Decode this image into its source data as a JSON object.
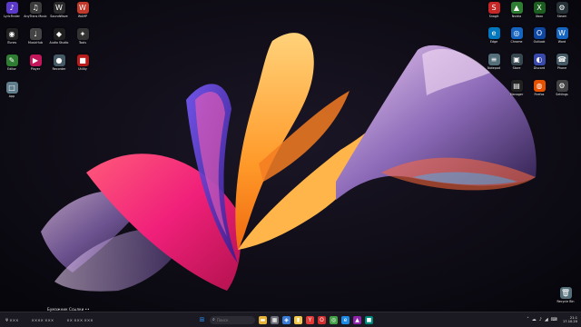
{
  "desktop": {
    "left_icons": [
      {
        "label": "LyricFinder",
        "glyph": "♪",
        "color": "#5a39c8"
      },
      {
        "label": "AnyTrans Music",
        "glyph": "♫",
        "color": "#3b3b3b"
      },
      {
        "label": "SoundWave",
        "glyph": "W",
        "color": "#2a2a2a"
      },
      {
        "label": "WAMP",
        "glyph": "W",
        "color": "#c0392b"
      },
      {
        "label": "iTunes",
        "glyph": "◉",
        "color": "#222222"
      },
      {
        "label": "MusicHub",
        "glyph": "♩",
        "color": "#444444"
      },
      {
        "label": "Audio Studio",
        "glyph": "◆",
        "color": "#1f1f1f"
      },
      {
        "label": "Tools",
        "glyph": "✦",
        "color": "#333333"
      },
      {
        "label": "Editor",
        "glyph": "✎",
        "color": "#2e7d32"
      },
      {
        "label": "Player",
        "glyph": "▶",
        "color": "#c2185b"
      },
      {
        "label": "Recorder",
        "glyph": "●",
        "color": "#455a64"
      },
      {
        "label": "Utility",
        "glyph": "■",
        "color": "#b71c1c"
      },
      {
        "label": "App",
        "glyph": "□",
        "color": "#607d8b"
      }
    ],
    "right_icons": [
      {
        "label": "Snagit",
        "glyph": "S",
        "color": "#c62828"
      },
      {
        "label": "Nvidia",
        "glyph": "▲",
        "color": "#2e7d32"
      },
      {
        "label": "Xbox",
        "glyph": "X",
        "color": "#1b5e20"
      },
      {
        "label": "Steam",
        "glyph": "⚙",
        "color": "#263238"
      },
      {
        "label": "Edge",
        "glyph": "e",
        "color": "#0277bd"
      },
      {
        "label": "Chrome",
        "glyph": "◎",
        "color": "#1565c0"
      },
      {
        "label": "Outlook",
        "glyph": "O",
        "color": "#0d47a1"
      },
      {
        "label": "Word",
        "glyph": "W",
        "color": "#1565c0"
      },
      {
        "label": "Notepad",
        "glyph": "≡",
        "color": "#546e7a"
      },
      {
        "label": "Store",
        "glyph": "▣",
        "color": "#37474f"
      },
      {
        "label": "Discord",
        "glyph": "◐",
        "color": "#3949ab"
      },
      {
        "label": "Phone",
        "glyph": "☎",
        "color": "#455a64"
      },
      {
        "label": "Manager",
        "glyph": "▤",
        "color": "#212121"
      },
      {
        "label": "Firefox",
        "glyph": "◍",
        "color": "#e65100"
      },
      {
        "label": "Settings",
        "glyph": "⚙",
        "color": "#424242"
      }
    ],
    "recycle_bin": {
      "label": "Recycle Bin",
      "glyph": "🗑",
      "color": "#546e7a"
    },
    "hover_tip": "Бумажник Ссылки ••"
  },
  "taskbar": {
    "left_items": [
      "Ψ ×××",
      "×××× ×××",
      "×× ××× ×××"
    ],
    "search_placeholder": "Поиск",
    "center_buttons": [
      {
        "name": "start-button",
        "glyph": "⊞",
        "color": "#2a8cf0"
      },
      {
        "name": "file-explorer-button",
        "glyph": "▬",
        "color": "#e6b23a"
      },
      {
        "name": "task-view-button",
        "glyph": "▦",
        "color": "#6d6d78"
      },
      {
        "name": "store-button",
        "glyph": "◈",
        "color": "#3a7bd5"
      },
      {
        "name": "explorer-button",
        "glyph": "▮",
        "color": "#f2c94c"
      },
      {
        "name": "yandex-button",
        "glyph": "Y",
        "color": "#e53935"
      },
      {
        "name": "opera-button",
        "glyph": "O",
        "color": "#d32f2f"
      },
      {
        "name": "chrome-button",
        "glyph": "◎",
        "color": "#43a047"
      },
      {
        "name": "edge-button",
        "glyph": "e",
        "color": "#1e88e5"
      },
      {
        "name": "app-button",
        "glyph": "▲",
        "color": "#8e24aa"
      },
      {
        "name": "app2-button",
        "glyph": "■",
        "color": "#00897b"
      }
    ],
    "tray_icons": [
      "˄",
      "☁",
      "♪",
      "◢",
      "⌨"
    ],
    "time": "21:1",
    "date": "17.10.20"
  }
}
